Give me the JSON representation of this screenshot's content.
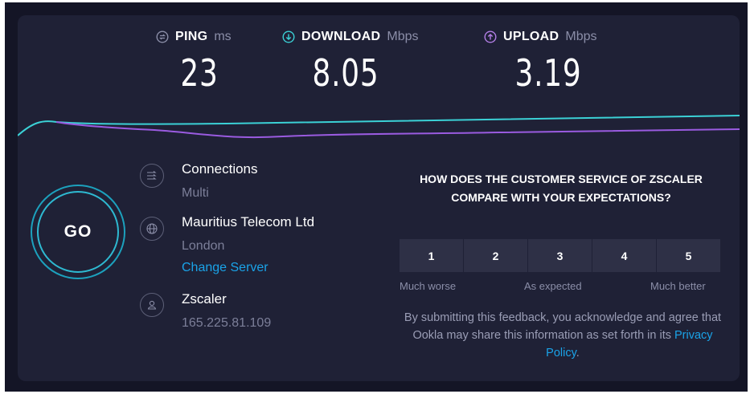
{
  "metrics": {
    "ping": {
      "label": "PING",
      "unit": "ms",
      "value": "23",
      "color": "#8b8ea8"
    },
    "download": {
      "label": "DOWNLOAD",
      "unit": "Mbps",
      "value": "8.05",
      "color": "#3bd1d6"
    },
    "upload": {
      "label": "UPLOAD",
      "unit": "Mbps",
      "value": "3.19",
      "color": "#b37fe6"
    }
  },
  "go_label": "GO",
  "connections": {
    "title": "Connections",
    "value": "Multi",
    "icon": "connections-icon"
  },
  "server": {
    "title": "Mauritius Telecom Ltd",
    "location": "London",
    "change_label": "Change Server",
    "icon": "globe-icon"
  },
  "provider": {
    "title": "Zscaler",
    "ip": "165.225.81.109",
    "icon": "user-icon"
  },
  "survey": {
    "question": "HOW DOES THE CUSTOMER SERVICE OF ZSCALER COMPARE WITH YOUR EXPECTATIONS?",
    "ratings": [
      "1",
      "2",
      "3",
      "4",
      "5"
    ],
    "scale_low": "Much worse",
    "scale_mid": "As expected",
    "scale_high": "Much better",
    "disclaimer": "By submitting this feedback, you acknowledge and agree that Ookla may share this information as set forth in its ",
    "privacy_link": "Privacy Policy",
    "period": "."
  },
  "colors": {
    "background": "#141526",
    "card": "#1f2136",
    "download_line": "#3bd1d6",
    "upload_line": "#9a5be0",
    "link": "#1aa3e8"
  }
}
